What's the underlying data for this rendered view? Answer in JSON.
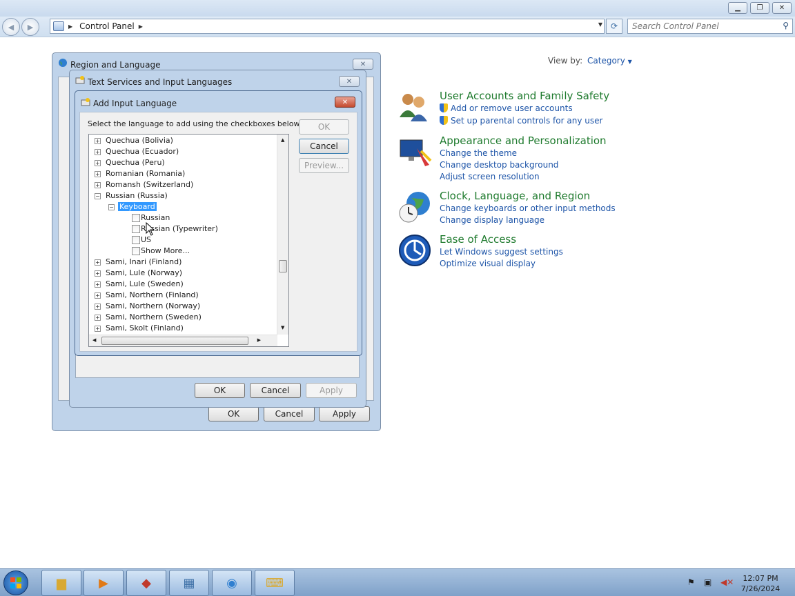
{
  "window": {
    "min_icon": "minimize-icon",
    "max_icon": "restore-icon",
    "close_icon": "close-icon"
  },
  "address": {
    "crumb": "Control Panel",
    "search_placeholder": "Search Control Panel"
  },
  "viewby": {
    "label": "View by:",
    "value": "Category"
  },
  "categories": [
    {
      "title": "User Accounts and Family Safety",
      "links": [
        "Add or remove user accounts",
        "Set up parental controls for any user"
      ],
      "icon": "users-icon"
    },
    {
      "title": "Appearance and Personalization",
      "links": [
        "Change the theme",
        "Change desktop background",
        "Adjust screen resolution"
      ],
      "icon": "monitor-paint-icon"
    },
    {
      "title": "Clock, Language, and Region",
      "links": [
        "Change keyboards or other input methods",
        "Change display language"
      ],
      "icon": "globe-clock-icon"
    },
    {
      "title": "Ease of Access",
      "links": [
        "Let Windows suggest settings",
        "Optimize visual display"
      ],
      "icon": "ease-of-access-icon"
    }
  ],
  "region_dialog": {
    "title": "Region and Language",
    "ok": "OK",
    "cancel": "Cancel",
    "apply": "Apply"
  },
  "text_services_dialog": {
    "title": "Text Services and Input Languages",
    "ok": "OK",
    "cancel": "Cancel",
    "apply": "Apply"
  },
  "add_input_dialog": {
    "title": "Add Input Language",
    "instruction": "Select the language to add using the checkboxes below.",
    "ok": "OK",
    "cancel": "Cancel",
    "preview": "Preview...",
    "tree": {
      "before": [
        "Quechua (Bolivia)",
        "Quechua (Ecuador)",
        "Quechua (Peru)",
        "Romanian (Romania)",
        "Romansh (Switzerland)"
      ],
      "expanded_language": "Russian (Russia)",
      "keyboard_node": "Keyboard",
      "keyboards": [
        "Russian",
        "Russian (Typewriter)",
        "US",
        "Show More..."
      ],
      "after": [
        "Sami, Inari (Finland)",
        "Sami, Lule (Norway)",
        "Sami, Lule (Sweden)",
        "Sami, Northern (Finland)",
        "Sami, Northern (Norway)",
        "Sami, Northern (Sweden)",
        "Sami, Skolt (Finland)"
      ]
    }
  },
  "taskbar": {
    "time": "12:07 PM",
    "date": "7/26/2024",
    "apps": [
      "explorer-icon",
      "media-player-icon",
      "app-red-icon",
      "control-panel-icon",
      "region-globe-icon",
      "text-services-icon"
    ]
  }
}
